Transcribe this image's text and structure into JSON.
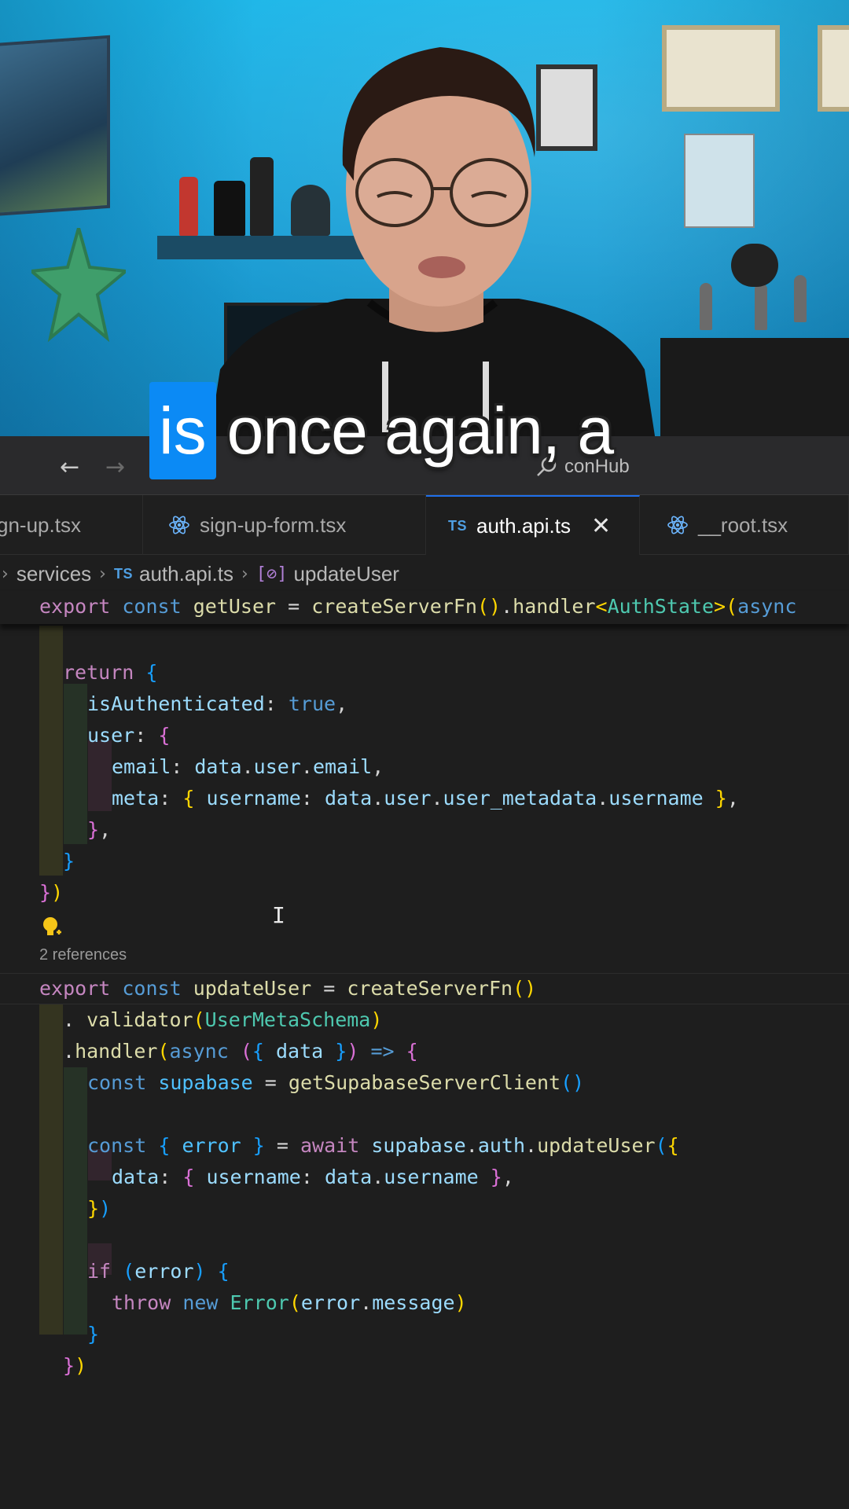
{
  "caption": {
    "highlight_word": "is",
    "rest": "once again, a"
  },
  "nav": {
    "back_glyph": "←",
    "forward_glyph": "→",
    "search_text": "conHub"
  },
  "tabs": [
    {
      "label": "gn-up.tsx",
      "icon": "react-icon",
      "active": false
    },
    {
      "label": "sign-up-form.tsx",
      "icon": "react-icon",
      "active": false
    },
    {
      "label": "auth.api.ts",
      "icon": "ts-icon",
      "active": true,
      "close": "✕"
    },
    {
      "label": "__root.tsx",
      "icon": "react-icon",
      "active": false
    }
  ],
  "ts_label": "TS",
  "breadcrumb": {
    "lead_sep": "›",
    "folder": "services",
    "sep": "›",
    "file_icon": "TS",
    "file": "auth.api.ts",
    "symbol_icon": "[⊘]",
    "symbol": "updateUser"
  },
  "code": {
    "sticky": [
      "export",
      "const",
      "getUser",
      "=",
      "createServerFn",
      "()",
      ".",
      "handler",
      "<",
      "AuthState",
      ">",
      "(",
      "async"
    ],
    "codelens": "2 references",
    "cursor": "I"
  },
  "colors": {
    "editor_bg": "#1e1e1e",
    "accent": "#1f6feb",
    "caption_highlight": "#0b8af5"
  }
}
